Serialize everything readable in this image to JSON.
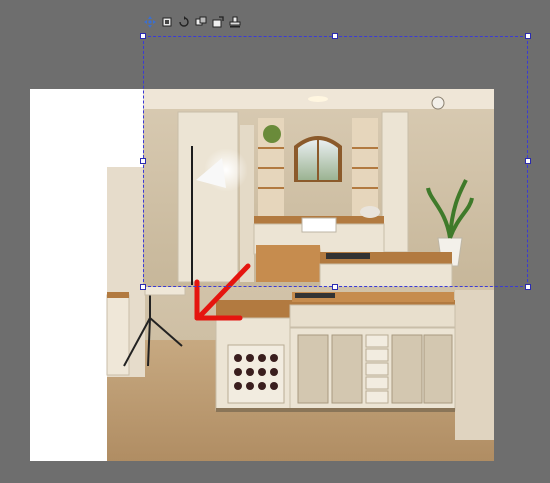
{
  "toolbar": {
    "icons": [
      "move-icon",
      "crop-icon",
      "rotate-icon",
      "flip-icon",
      "replace-icon",
      "stamp-icon"
    ]
  },
  "colors": {
    "canvas_bg": "#6e6e6e",
    "selection_border": "#3a3ad6",
    "arrow": "#e5150f",
    "wood": "#b27a40",
    "cabinet": "#ece4d4"
  },
  "annotation": {
    "arrow_direction": "down-left"
  }
}
